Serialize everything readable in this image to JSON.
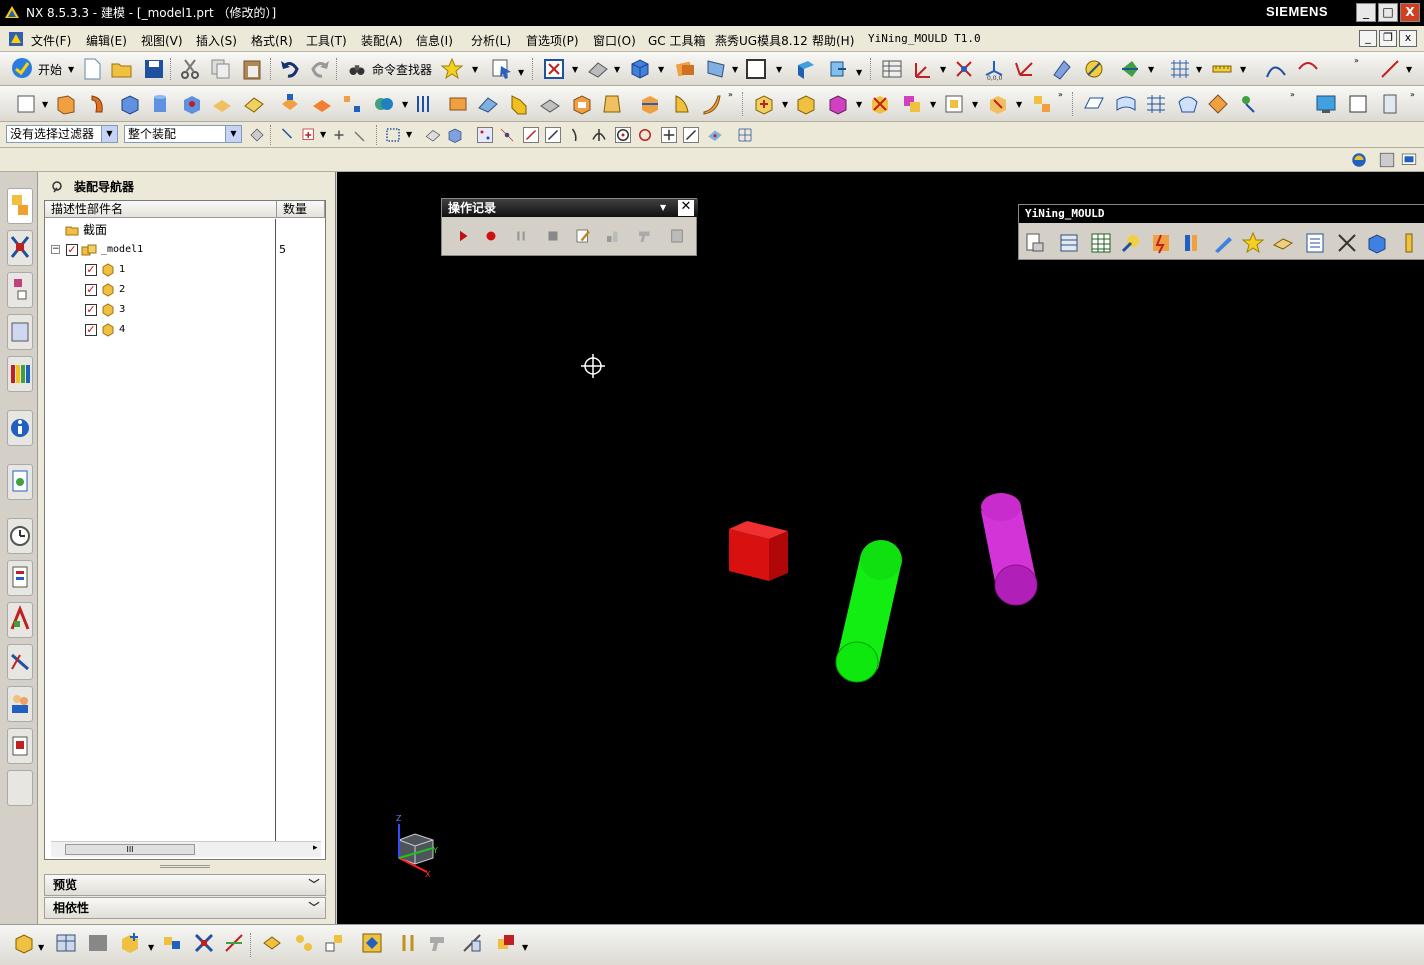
{
  "window": {
    "title": "NX 8.5.3.3 - 建模 - [_model1.prt （修改的）]",
    "brand": "SIEMENS",
    "buttons": [
      "_",
      "□",
      "X"
    ]
  },
  "menubar": {
    "items": [
      "文件(F)",
      "编辑(E)",
      "视图(V)",
      "插入(S)",
      "格式(R)",
      "工具(T)",
      "装配(A)",
      "信息(I)",
      "分析(L)",
      "首选项(P)",
      "窗口(O)",
      "GC 工具箱",
      "燕秀UG模具8.12",
      "帮助(H)",
      "YiNing_MOULD T1.0"
    ],
    "mdi_buttons": [
      "_",
      "❐",
      "x"
    ]
  },
  "toolbar": {
    "start_label": "开始",
    "command_finder_label": "命令查找器",
    "selection_filter": "没有选择过滤器",
    "assembly_scope": "整个装配"
  },
  "navigator": {
    "title": "装配导航器",
    "columns": [
      "描述性部件名",
      "数量"
    ],
    "rows": [
      {
        "label": "截面",
        "qty": ""
      },
      {
        "label": "_model1",
        "qty": "5"
      },
      {
        "label": "1",
        "qty": ""
      },
      {
        "label": "2",
        "qty": ""
      },
      {
        "label": "3",
        "qty": ""
      },
      {
        "label": "4",
        "qty": ""
      }
    ],
    "scroll_grip": "III",
    "sections": [
      "预览",
      "相依性"
    ]
  },
  "op_recorder": {
    "title": "操作记录"
  },
  "yining": {
    "title": "YiNing_MOULD"
  },
  "triad": {
    "z": "Z",
    "y": "Y",
    "x": "X"
  },
  "colors": {
    "cube": "#e01010",
    "cylinder_green": "#10ee10",
    "cylinder_magenta": "#d030d8",
    "accent": "#1e4aa0"
  }
}
